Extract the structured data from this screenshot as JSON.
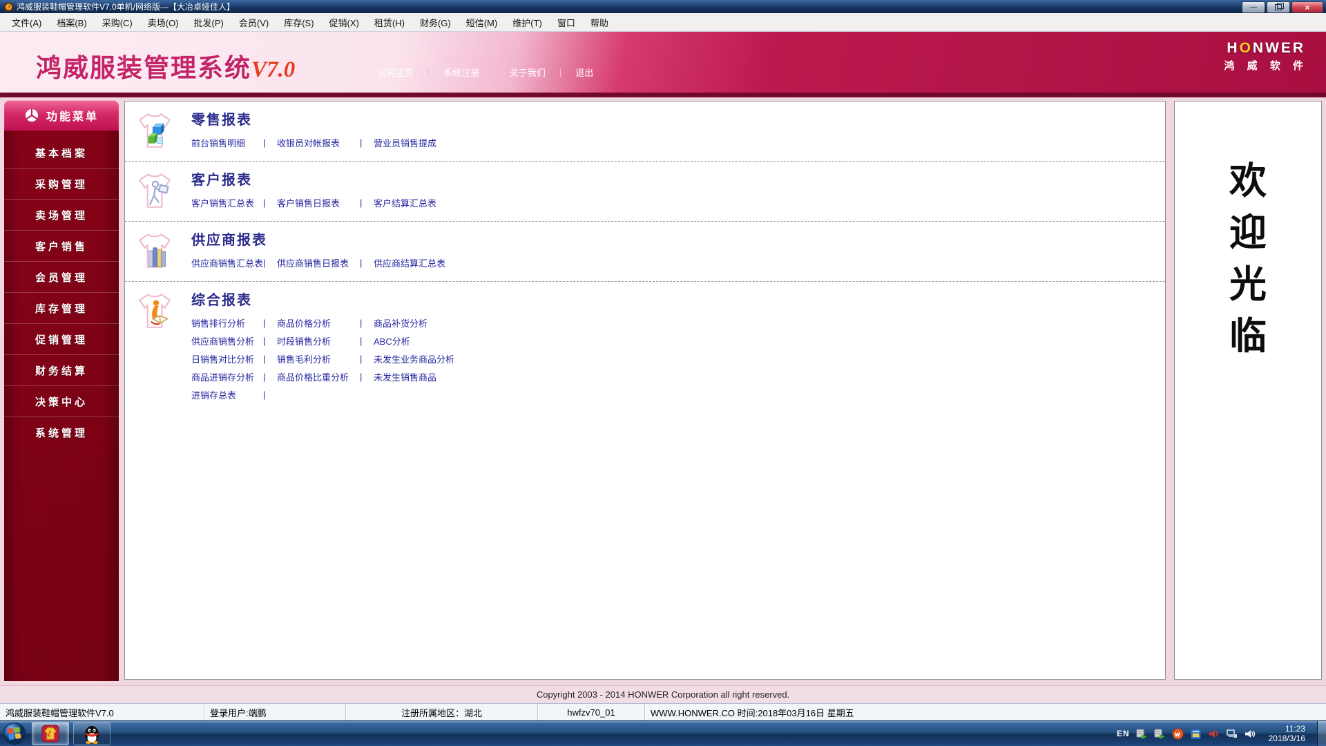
{
  "ui": {
    "pipe": "|"
  },
  "colors": {
    "sidebar_crimson": "#b11347",
    "banner_magenta": "#b11446",
    "banner_light_pink": "#fbe4ee",
    "logo_magenta": "#c42468",
    "version_orange": "#e53d20",
    "link_navy": "#2626a0",
    "title_navy_blue": "#16335f",
    "taskbar_blue": "#24507f",
    "brand_gold": "#ffc61a"
  },
  "window": {
    "title": "鸿威服装鞋帽管理软件V7.0单机/网络版---【大冶卓娅佳人】",
    "minimize_glyph": "—",
    "close_glyph": "×"
  },
  "menu": {
    "items": [
      "文件(A)",
      "档案(B)",
      "采购(C)",
      "卖场(O)",
      "批发(P)",
      "会员(V)",
      "库存(S)",
      "促销(X)",
      "租赁(H)",
      "财务(G)",
      "短信(M)",
      "维护(T)",
      "窗口",
      "帮助"
    ]
  },
  "header": {
    "logo_title": "鸿威服装管理系统",
    "logo_version": "V7.0",
    "brand_en_left": "H",
    "brand_en_o": "O",
    "brand_en_right": "NWER",
    "brand_cn": "鸿 威 软 件",
    "nav": [
      "公司主页",
      "系统注册",
      "关于我们",
      "退出"
    ]
  },
  "sidebar": {
    "header": "功能菜单",
    "items": [
      "基本档案",
      "采购管理",
      "卖场管理",
      "客户销售",
      "会员管理",
      "库存管理",
      "促销管理",
      "财务结算",
      "决策中心",
      "系统管理"
    ]
  },
  "main": {
    "sections": [
      {
        "title": "零售报表",
        "icon": "tshirt-cubes-icon",
        "rows": [
          [
            "前台销售明细",
            "收银员对帐报表",
            "营业员销售提成"
          ]
        ]
      },
      {
        "title": "客户报表",
        "icon": "tshirt-customer-icon",
        "rows": [
          [
            "客户销售汇总表",
            "客户销售日报表",
            "客户结算汇总表"
          ]
        ]
      },
      {
        "title": "供应商报表",
        "icon": "tshirt-bars-icon",
        "rows": [
          [
            "供应商销售汇总表",
            "供应商销售日报表",
            "供应商结算汇总表"
          ]
        ]
      },
      {
        "title": "综合报表",
        "icon": "tshirt-analysis-icon",
        "rows": [
          [
            "销售排行分析",
            "商品价格分析",
            "商品补货分析"
          ],
          [
            "供应商销售分析",
            "时段销售分析",
            "ABC分析"
          ],
          [
            "日销售对比分析",
            "销售毛利分析",
            "未发生业务商品分析"
          ],
          [
            "商品进销存分析",
            "商品价格比重分析",
            "未发生销售商品"
          ],
          [
            "进销存总表"
          ]
        ]
      }
    ]
  },
  "welcome": {
    "chars": [
      "欢",
      "迎",
      "光",
      "临"
    ]
  },
  "footer": {
    "copyright": "Copyright 2003 - 2014 HONWER Corporation all right reserved."
  },
  "status": {
    "segments": [
      "鸿威服装鞋帽管理软件V7.0",
      "登录用户:端鹏",
      "注册所属地区：湖北",
      "hwfzv70_01",
      "WWW.HONWER.CO 时间:2018年03月16日  星期五"
    ]
  },
  "taskbar": {
    "lang": "EN",
    "time": "11:23",
    "date": "2018/3/16"
  }
}
